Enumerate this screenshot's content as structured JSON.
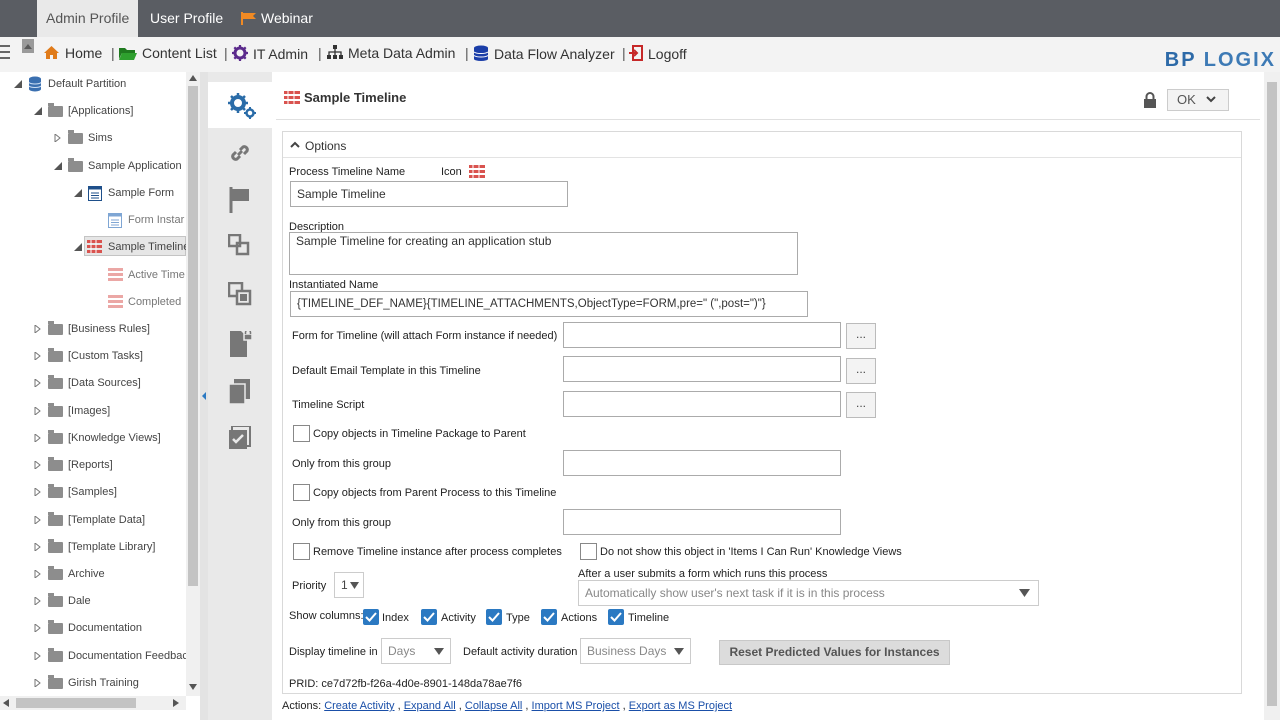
{
  "top_tabs": {
    "admin_profile": "Admin Profile",
    "user_profile": "User Profile",
    "webinar": "Webinar"
  },
  "nav": {
    "home": "Home",
    "content_list": "Content List",
    "it_admin": "IT Admin",
    "meta_data_admin": "Meta Data Admin",
    "data_flow_analyzer": "Data Flow Analyzer",
    "logoff": "Logoff",
    "separator": "|"
  },
  "brand": {
    "bp": "BP",
    "logix": "LOGIX"
  },
  "tree": {
    "default_partition": "Default Partition",
    "applications": "[Applications]",
    "sims": "Sims",
    "sample_application": "Sample Application",
    "sample_form": "Sample Form",
    "form_instances": "Form Instar",
    "sample_timeline": "Sample Timeline",
    "active_timelines": "Active Time",
    "completed": "Completed",
    "business_rules": "[Business Rules]",
    "custom_tasks": "[Custom Tasks]",
    "data_sources": "[Data Sources]",
    "images": "[Images]",
    "knowledge_views": "[Knowledge Views]",
    "reports": "[Reports]",
    "samples": "[Samples]",
    "template_data": "[Template Data]",
    "template_library": "[Template Library]",
    "archive": "Archive",
    "dale": "Dale",
    "documentation": "Documentation",
    "documentation_feedback": "Documentation Feedbac",
    "girish_training": "Girish Training"
  },
  "header": {
    "title": "Sample Timeline",
    "ok_label": "OK"
  },
  "options": {
    "section_label": "Options",
    "process_timeline_name_label": "Process Timeline Name",
    "icon_label": "Icon",
    "process_timeline_name_value": "Sample Timeline",
    "description_label": "Description",
    "description_value": "Sample Timeline for creating an application stub",
    "instantiated_name_label": "Instantiated Name",
    "instantiated_name_value": "{TIMELINE_DEF_NAME}{TIMELINE_ATTACHMENTS,ObjectType=FORM,pre=\" (\",post=\")\"}",
    "form_for_timeline_label": "Form for Timeline (will attach Form instance if needed)",
    "default_email_template_label": "Default Email Template in this Timeline",
    "timeline_script_label": "Timeline Script",
    "browse_label": "...",
    "copy_to_parent_label": "Copy objects in Timeline Package to Parent",
    "only_from_group_label": "Only from this group",
    "copy_from_parent_label": "Copy objects from Parent Process to this Timeline",
    "remove_instance_label": "Remove Timeline instance after process completes",
    "do_not_show_label": "Do not show this object in 'Items I Can Run' Knowledge Views",
    "priority_label": "Priority",
    "priority_value": "1",
    "after_submit_label": "After a user submits a form which runs this process",
    "after_submit_value": "Automatically show user's next task if it is in this process",
    "show_columns_label": "Show columns:",
    "columns": {
      "index": "Index",
      "activity": "Activity",
      "type": "Type",
      "actions": "Actions",
      "timeline": "Timeline"
    },
    "display_timeline_in_label": "Display timeline in",
    "display_timeline_in_value": "Days",
    "default_activity_duration_label": "Default activity duration",
    "default_activity_duration_value": "Business Days",
    "reset_button": "Reset Predicted Values for Instances",
    "prid_label": "PRID:",
    "prid_value": "ce7d72fb-f26a-4d0e-8901-148da78ae7f6"
  },
  "actions": {
    "label": "Actions:",
    "create_activity": "Create Activity",
    "expand_all": "Expand All",
    "collapse_all": "Collapse All",
    "import_ms_project": "Import MS Project",
    "export_ms_project": "Export as MS Project",
    "comma": ","
  },
  "colors": {
    "topbar": "#5a5d63",
    "accent_blue": "#2b79c2",
    "link": "#1a4fa8",
    "timeline_red": "#d9534f"
  }
}
